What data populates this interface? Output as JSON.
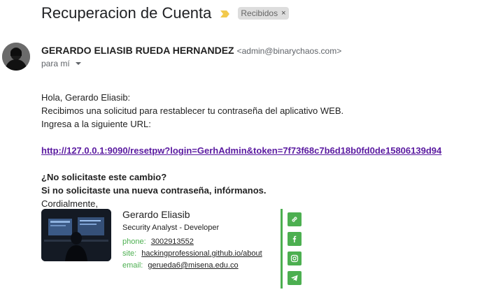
{
  "email": {
    "subject": "Recuperacion de Cuenta",
    "label": "Recibidos",
    "label_close": "×",
    "sender_name": "GERARDO ELIASIB RUEDA HERNANDEZ",
    "sender_email": "<admin@binarychaos.com>",
    "to_text": "para mí"
  },
  "body": {
    "greeting": "Hola, Gerardo Eliasib:",
    "line1": "Recibimos una solicitud para restablecer tu contraseña del aplicativo WEB.",
    "line2": "Ingresa a la siguiente URL:",
    "reset_link": "http://127.0.0.1:9090/resetpw?login=GerhAdmin&token=7f73f68c7b6d18b0fd0de15806139d94",
    "question": "¿No solicitaste este cambio?",
    "notice": "Si no solicitaste una nueva contraseña, infórmanos.",
    "closing": "Cordialmente,"
  },
  "signature": {
    "name": "Gerardo Eliasib",
    "role": "Security Analyst - Developer",
    "phone_label": "phone:",
    "phone": "3002913552",
    "site_label": "site:",
    "site": "hackingprofessional.github.io/about",
    "email_label": "email:",
    "email": "gerueda6@misena.edu.co",
    "icons": [
      "link-icon",
      "facebook-icon",
      "instagram-icon",
      "telegram-icon"
    ]
  },
  "colors": {
    "accent_green": "#4caf50",
    "link_purple": "#5a1aa0",
    "important_marker": "#f2c94c",
    "label_chip_bg": "#dddddd"
  }
}
